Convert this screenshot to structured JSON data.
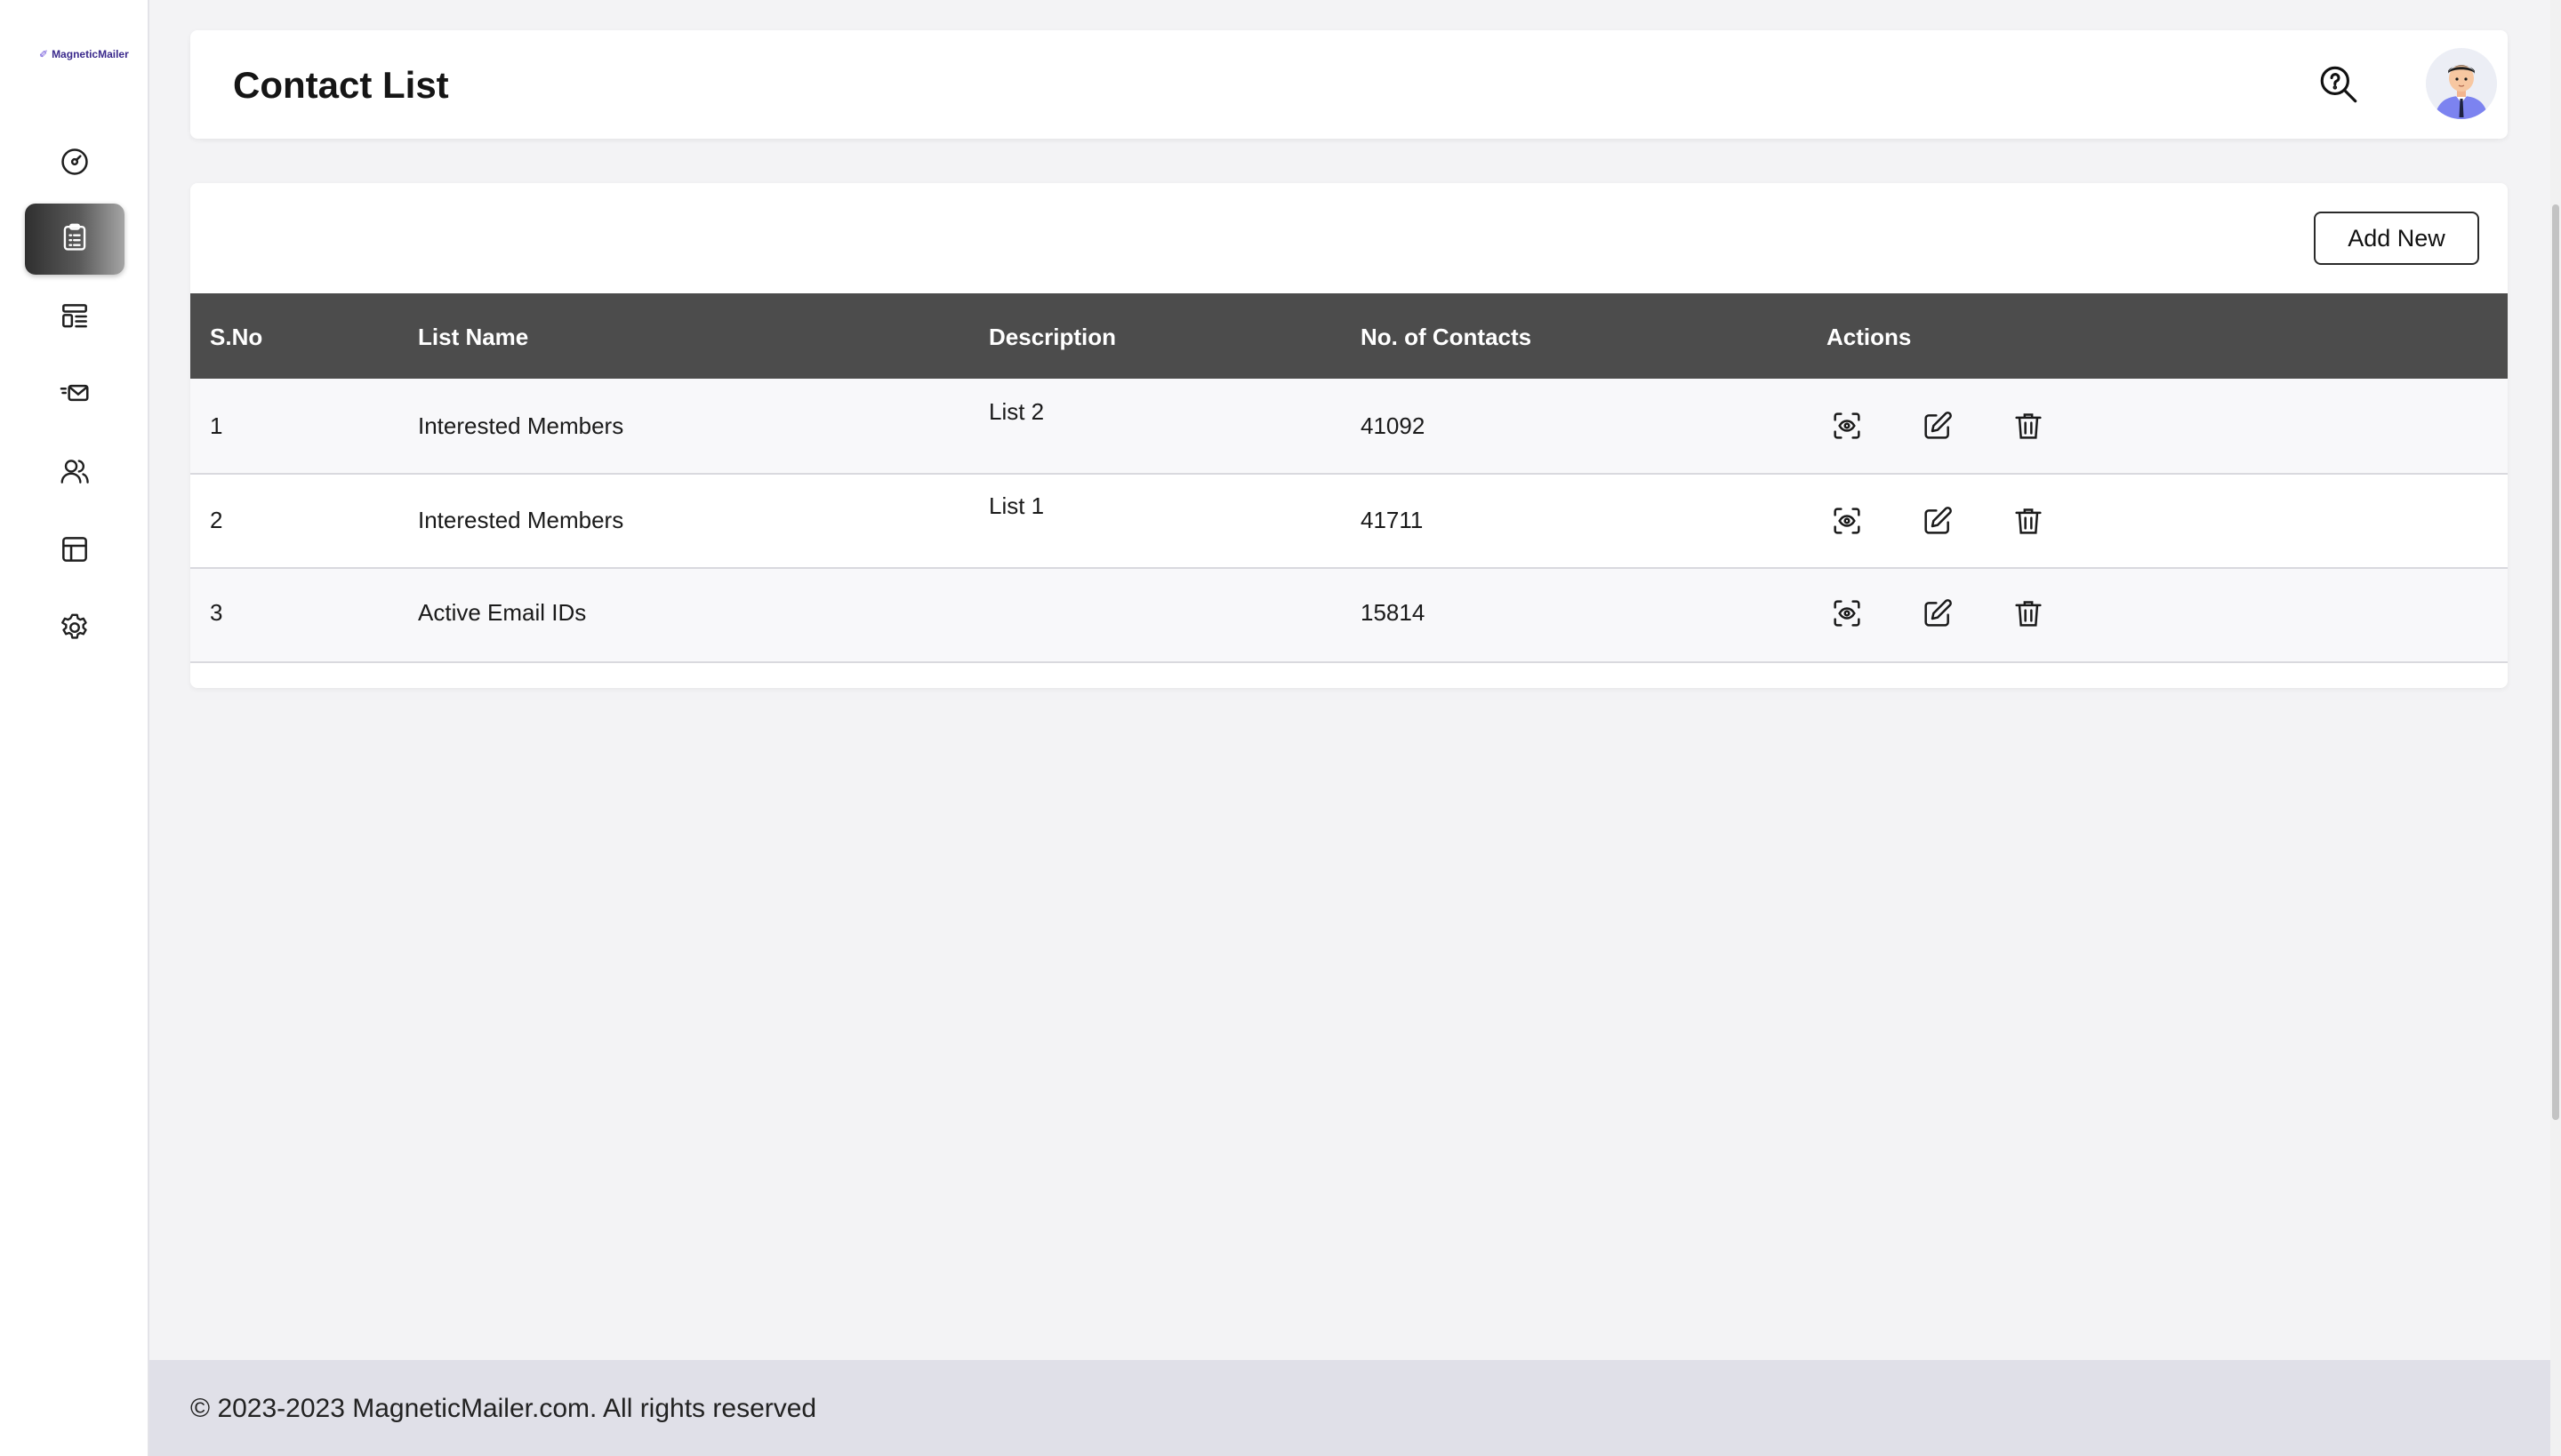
{
  "brand": {
    "name": "MagneticMailer"
  },
  "sidebar": {
    "items": [
      {
        "icon": "dashboard-gauge-icon",
        "active": false
      },
      {
        "icon": "clipboard-list-icon",
        "active": true
      },
      {
        "icon": "template-layout-icon",
        "active": false
      },
      {
        "icon": "send-mail-icon",
        "active": false
      },
      {
        "icon": "users-icon",
        "active": false
      },
      {
        "icon": "table-grid-icon",
        "active": false
      },
      {
        "icon": "gear-icon",
        "active": false
      }
    ]
  },
  "header": {
    "title": "Contact List",
    "help_icon": "help-search-icon",
    "avatar": "user-avatar"
  },
  "toolbar": {
    "add_label": "Add New"
  },
  "table": {
    "columns": [
      "S.No",
      "List Name",
      "Description",
      "No. of Contacts",
      "Actions"
    ],
    "rows": [
      {
        "sno": "1",
        "name": "Interested Members",
        "description": "List 2",
        "contacts": "41092"
      },
      {
        "sno": "2",
        "name": "Interested Members",
        "description": "List 1",
        "contacts": "41711"
      },
      {
        "sno": "3",
        "name": "Active Email IDs",
        "description": "",
        "contacts": "15814"
      }
    ],
    "action_icons": [
      "view-icon",
      "edit-icon",
      "delete-icon"
    ]
  },
  "footer": {
    "text": "© 2023-2023 MagneticMailer.com. All rights reserved"
  },
  "colors": {
    "header_bg": "#4c4c4c",
    "active_nav": "#2f2f2f",
    "footer_bg": "#e0e0e8",
    "brand": "#3b2a8c"
  }
}
